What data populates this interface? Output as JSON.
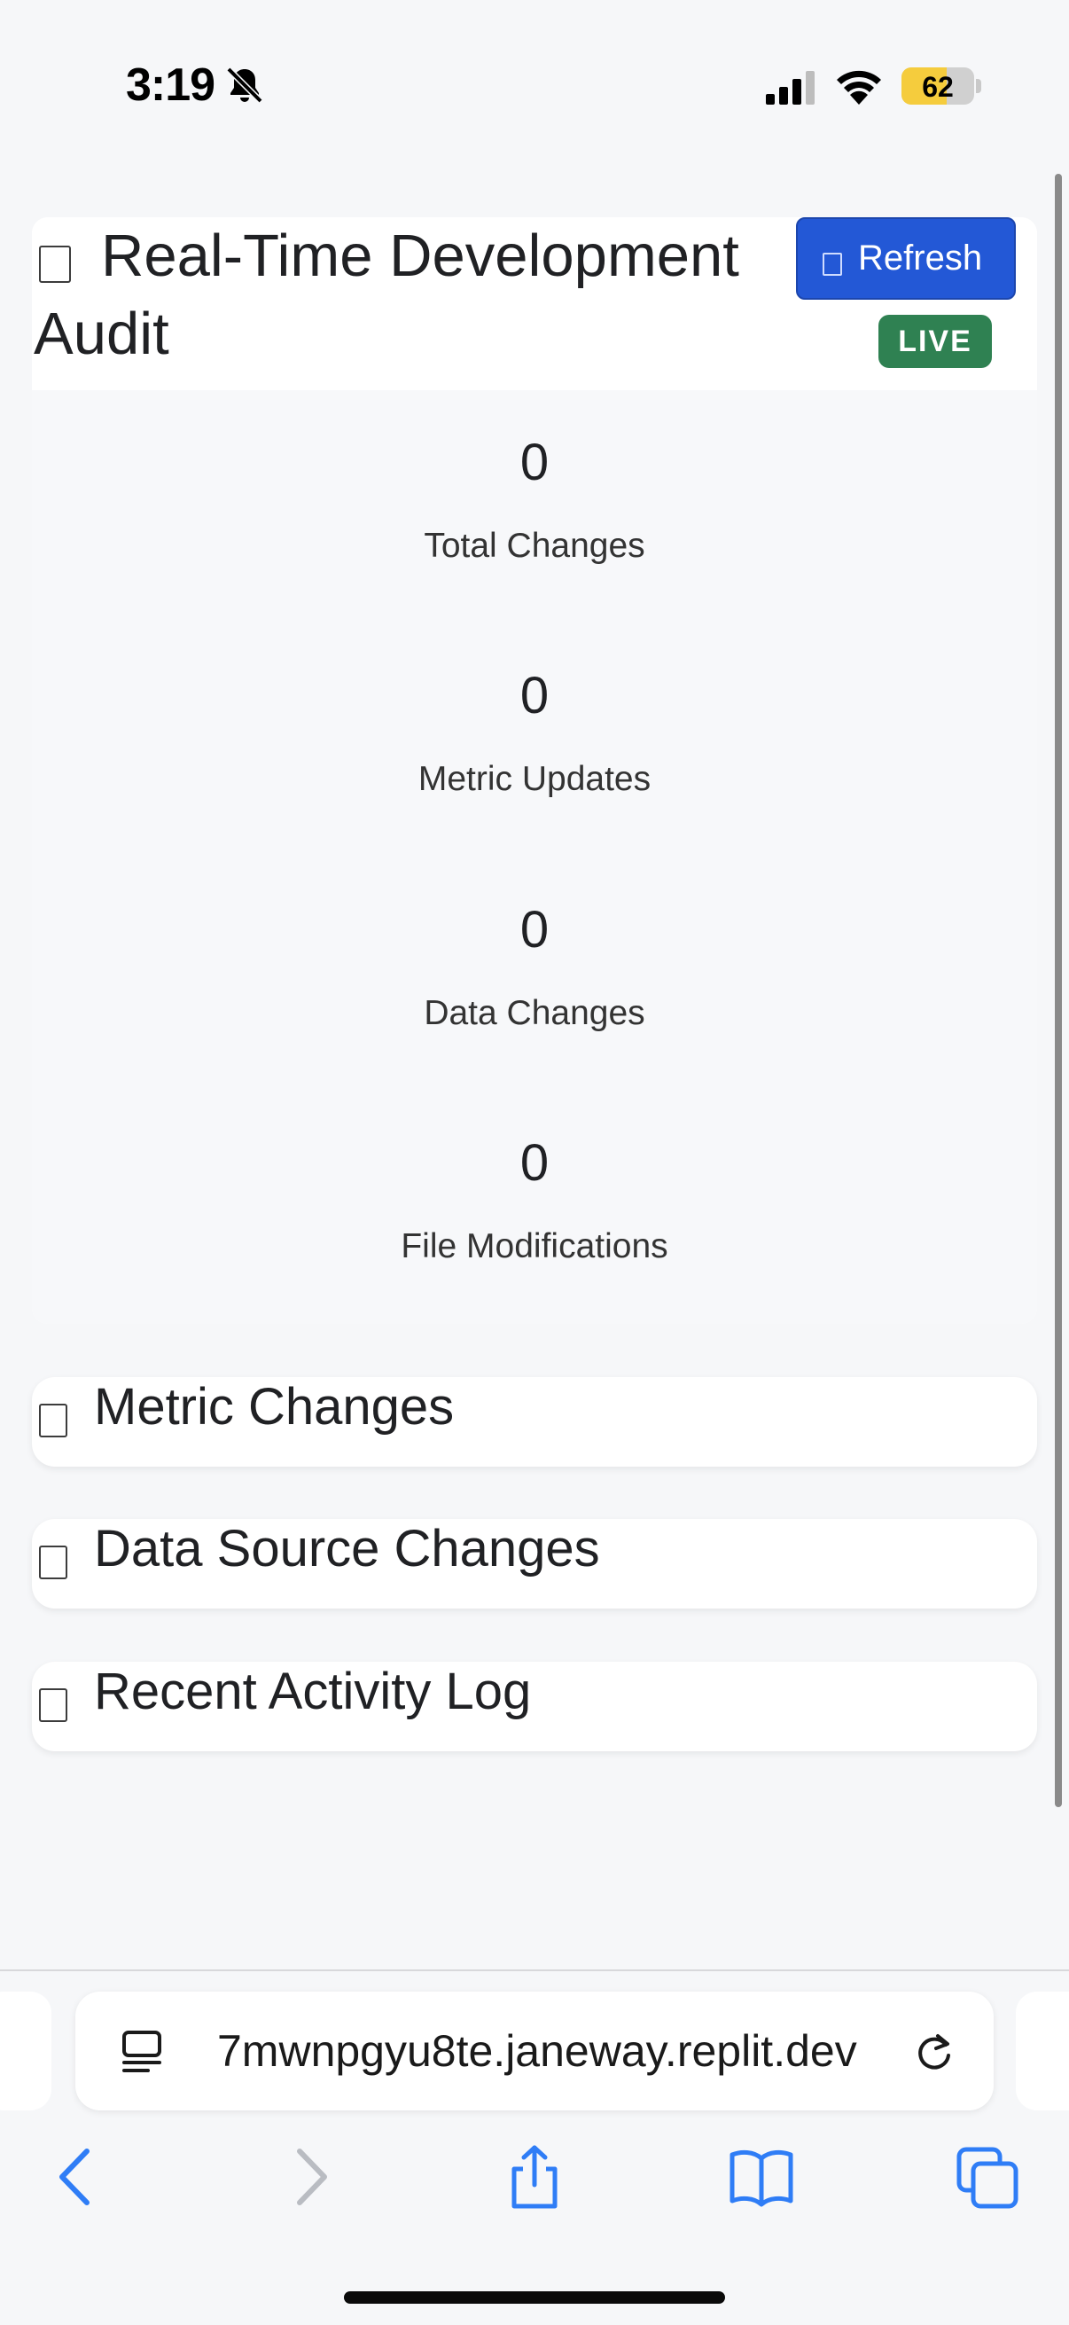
{
  "status_bar": {
    "time": "3:19",
    "battery_level": "62",
    "battery_fraction": 0.62,
    "icons": [
      "bell-slash-icon",
      "cellular-signal-icon",
      "wifi-icon",
      "battery-icon"
    ]
  },
  "audit": {
    "title": "Real-Time Development Audit",
    "refresh_label": "Refresh",
    "live_badge": "LIVE",
    "stats": [
      {
        "value": "0",
        "label": "Total Changes"
      },
      {
        "value": "0",
        "label": "Metric Updates"
      },
      {
        "value": "0",
        "label": "Data Changes"
      },
      {
        "value": "0",
        "label": "File Modifications"
      }
    ]
  },
  "sections": [
    {
      "title": "Metric Changes"
    },
    {
      "title": "Data Source Changes"
    },
    {
      "title": "Recent Activity Log"
    }
  ],
  "browser": {
    "url": "7mwnpgyu8te.janeway.replit.dev",
    "toolbar": [
      "back-icon",
      "forward-icon",
      "share-icon",
      "bookmarks-icon",
      "tabs-icon"
    ]
  },
  "colors": {
    "accent_blue": "#2358d6",
    "live_green": "#2f8152",
    "ios_blue": "#2f7df6",
    "battery_yellow": "#f5cc3d",
    "background": "#f6f7f9"
  }
}
